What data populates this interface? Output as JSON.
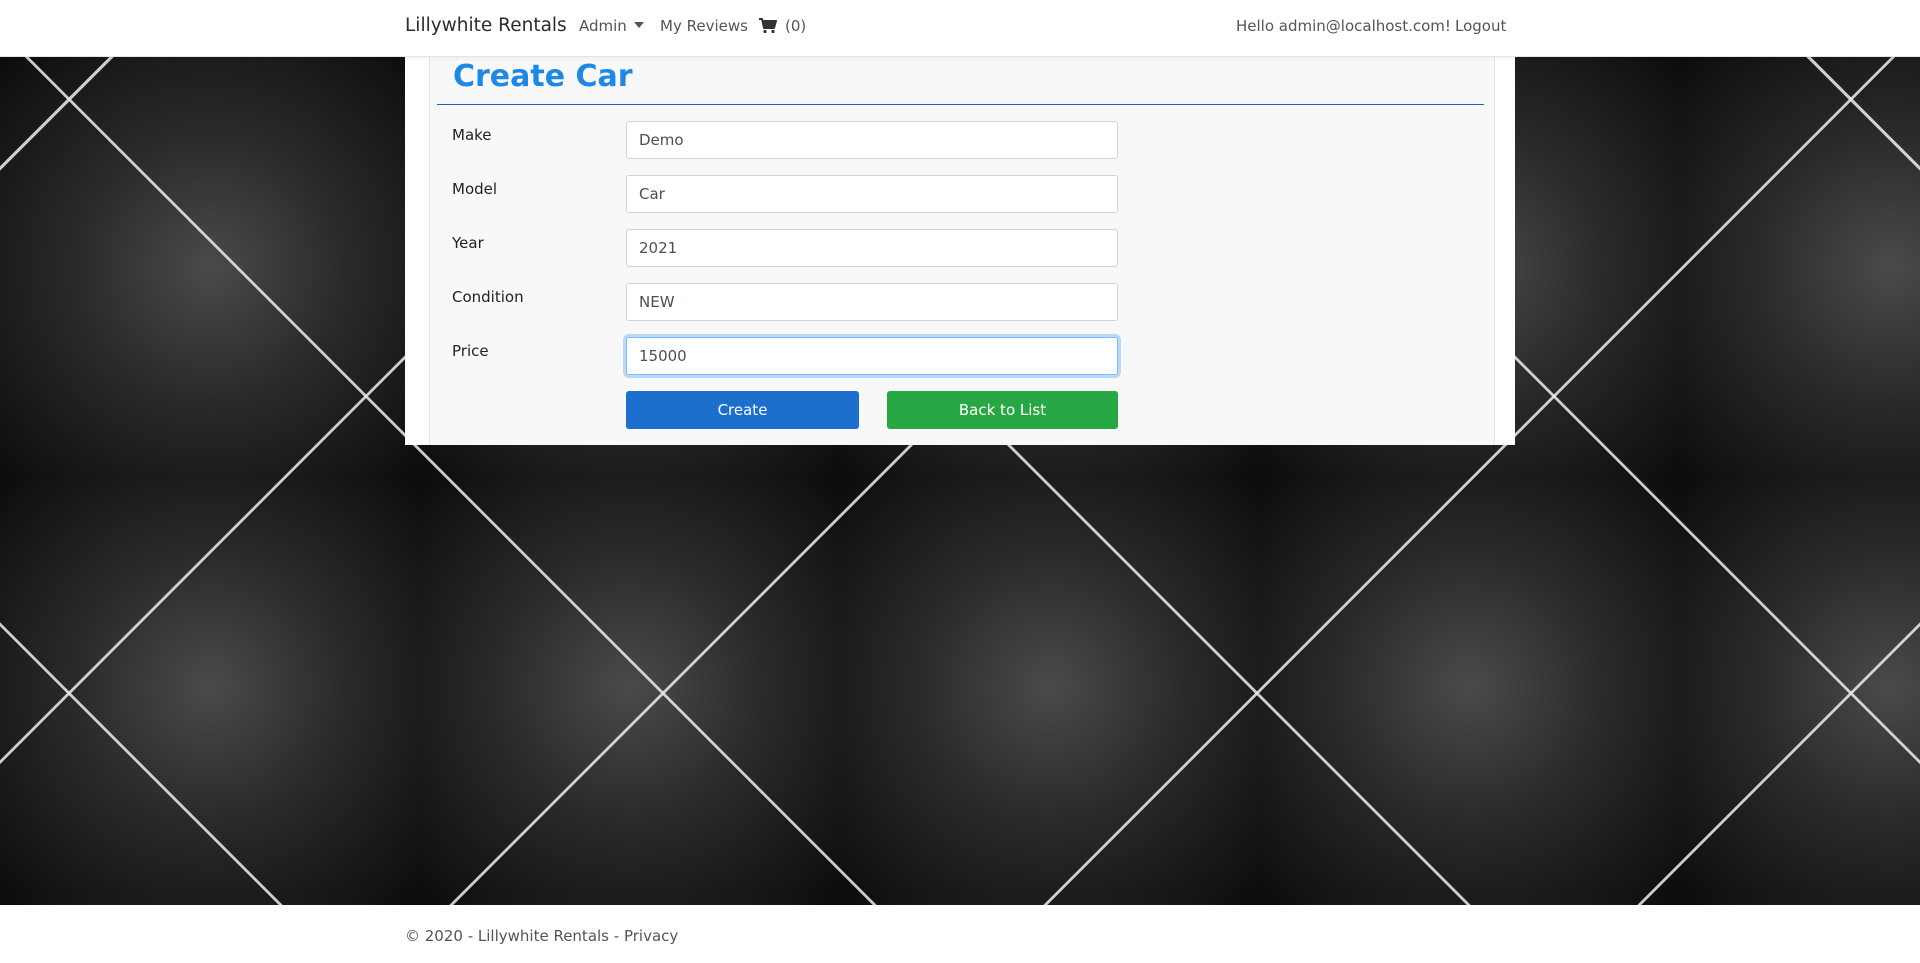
{
  "navbar": {
    "brand": "Lillywhite Rentals",
    "admin": "Admin",
    "reviews": "My Reviews",
    "cart_count": "(0)",
    "greeting": "Hello admin@localhost.com!",
    "logout": "Logout"
  },
  "form": {
    "title": "Create Car",
    "fields": [
      {
        "label": "Make",
        "value": "Demo"
      },
      {
        "label": "Model",
        "value": "Car"
      },
      {
        "label": "Year",
        "value": "2021"
      },
      {
        "label": "Condition",
        "value": "NEW"
      },
      {
        "label": "Price",
        "value": "15000"
      }
    ],
    "create_label": "Create",
    "back_label": "Back to List"
  },
  "footer": {
    "copyright": "© 2020 - Lillywhite Rentals -",
    "privacy": "Privacy"
  },
  "colors": {
    "title": "#1e88e5",
    "create_button": "#1c6fcc",
    "back_button": "#28a745"
  },
  "icons": {
    "cart": "shopping-cart-icon",
    "dropdown": "caret-down-icon"
  }
}
